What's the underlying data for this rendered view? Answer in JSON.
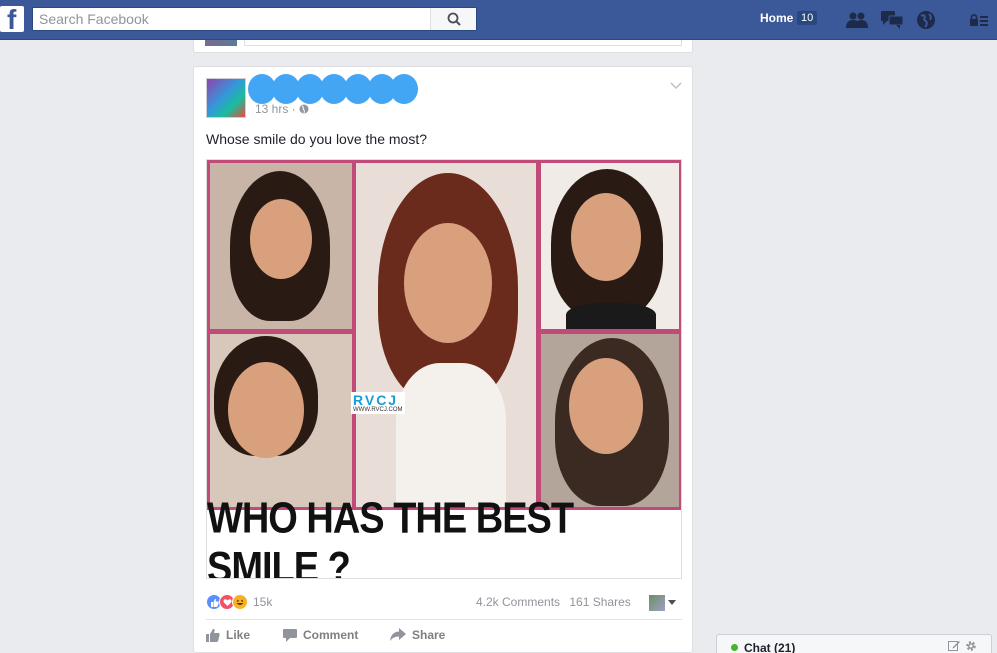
{
  "topbar": {
    "logo": "f",
    "search_placeholder": "Search Facebook",
    "home_label": "Home",
    "home_count": "10",
    "icons": [
      "friends-icon",
      "messages-icon",
      "notifications-globe-icon",
      "privacy-lock-icon"
    ]
  },
  "post": {
    "time": "13 hrs ·",
    "caption": "Whose smile do you love the most?",
    "image": {
      "banner_text": "WHO HAS THE BEST SMILE ?",
      "watermark_title": "RVCJ",
      "watermark_sub": "WWW.RVCJ.COM"
    },
    "reactions": {
      "types": [
        "like",
        "love",
        "haha"
      ],
      "count": "15k"
    },
    "comments": "4.2k Comments",
    "shares": "161 Shares",
    "actions": {
      "like": "Like",
      "comment": "Comment",
      "share": "Share"
    }
  },
  "chat": {
    "label": "Chat (21)"
  },
  "colors": {
    "brand": "#3b5998",
    "like_blue": "#5890ff",
    "love_red": "#f25268",
    "haha_yellow": "#f7b125",
    "online_green": "#42b72a",
    "redaction": "#43a6f5"
  }
}
